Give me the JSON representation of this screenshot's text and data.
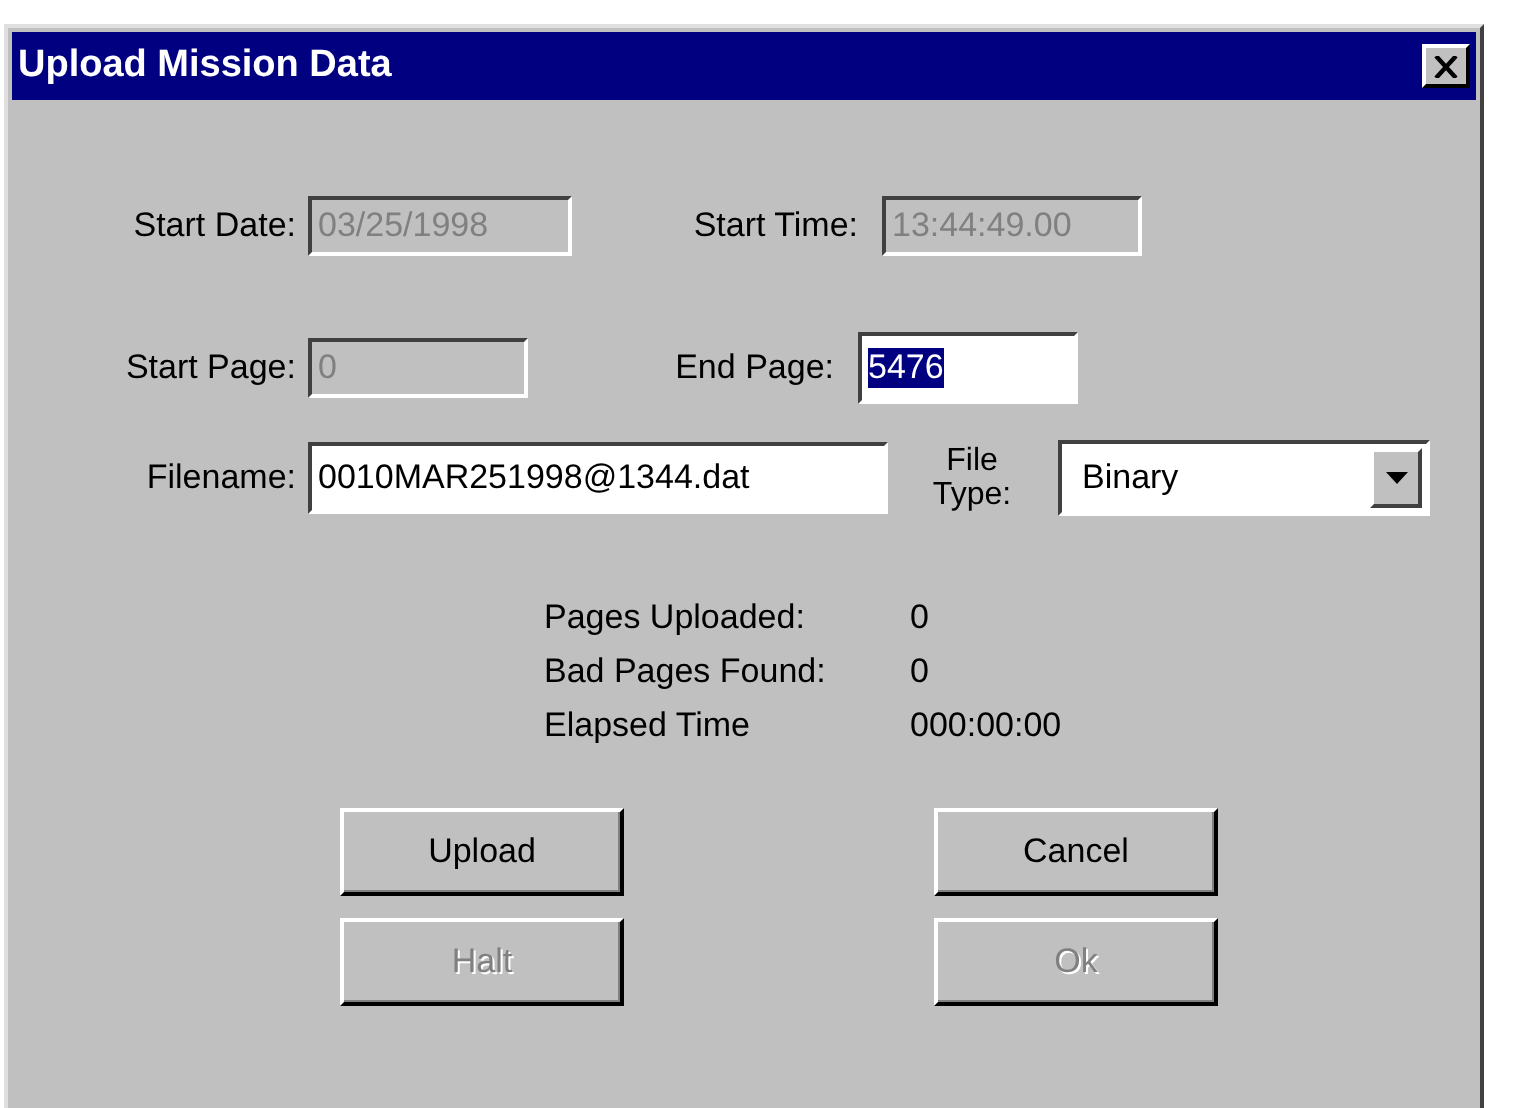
{
  "window": {
    "title": "Upload Mission Data"
  },
  "rows": [
    {
      "fields": [
        {
          "label": "Start Date:",
          "value": "03/25/1998",
          "disabled": true,
          "highlighted": false
        },
        {
          "label": "Start Time:",
          "value": "13:44:49.00",
          "disabled": true,
          "highlighted": false
        }
      ]
    },
    {
      "fields": [
        {
          "label": "Start Page:",
          "value": "0",
          "disabled": true,
          "highlighted": false
        },
        {
          "label": "End Page:",
          "value": "5476",
          "disabled": false,
          "highlighted": true
        }
      ]
    }
  ],
  "filename": {
    "label": "Filename:",
    "value": "0010MAR251998@1344.dat",
    "disabled": false
  },
  "file_type": {
    "label_lines": [
      "File",
      "Type:"
    ],
    "value": "Binary"
  },
  "stats": [
    {
      "label": "Pages Uploaded:",
      "value": "0"
    },
    {
      "label": "Bad Pages Found:",
      "value": "0"
    },
    {
      "label": "Elapsed Time",
      "value": "000:00:00"
    }
  ],
  "buttons": [
    {
      "label": "Upload",
      "disabled": false
    },
    {
      "label": "Cancel",
      "disabled": false
    },
    {
      "label": "Halt",
      "disabled": true
    },
    {
      "label": "Ok",
      "disabled": true
    }
  ]
}
